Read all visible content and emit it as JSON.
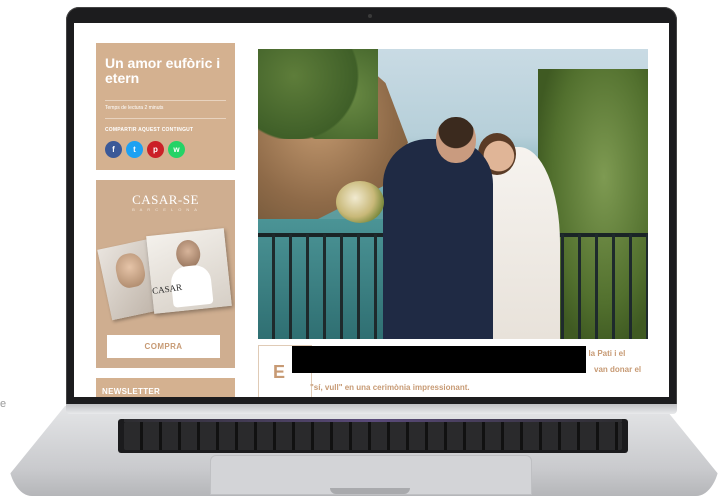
{
  "page": {
    "edge_text": "e"
  },
  "sidebar": {
    "title": "Un amor eufòric i etern",
    "reading_time": "Temps de lectura 2 minuts",
    "share_label": "COMPARTIR AQUEST CONTINGUT",
    "share_buttons": [
      {
        "icon": "facebook-icon",
        "glyph": "f",
        "color": "#3b5998"
      },
      {
        "icon": "twitter-icon",
        "glyph": "t",
        "color": "#1da1f2"
      },
      {
        "icon": "pinterest-icon",
        "glyph": "p",
        "color": "#cb2027"
      },
      {
        "icon": "whatsapp-icon",
        "glyph": "w",
        "color": "#25d366"
      }
    ]
  },
  "magazine": {
    "logo": "CASAR-SE",
    "subtitle": "B A R C E L O N A",
    "cover_word": "CASAR",
    "buy_label": "COMPRA"
  },
  "newsletter": {
    "label": "NEWSLETTER"
  },
  "article": {
    "dropcap": "E",
    "line1": ", la Pati i el",
    "line2": "van donar el",
    "line3": "\"sí, vull\" en una cerimònia impressionant."
  },
  "colors": {
    "accent": "#c79a74",
    "card": "#d4b190"
  }
}
